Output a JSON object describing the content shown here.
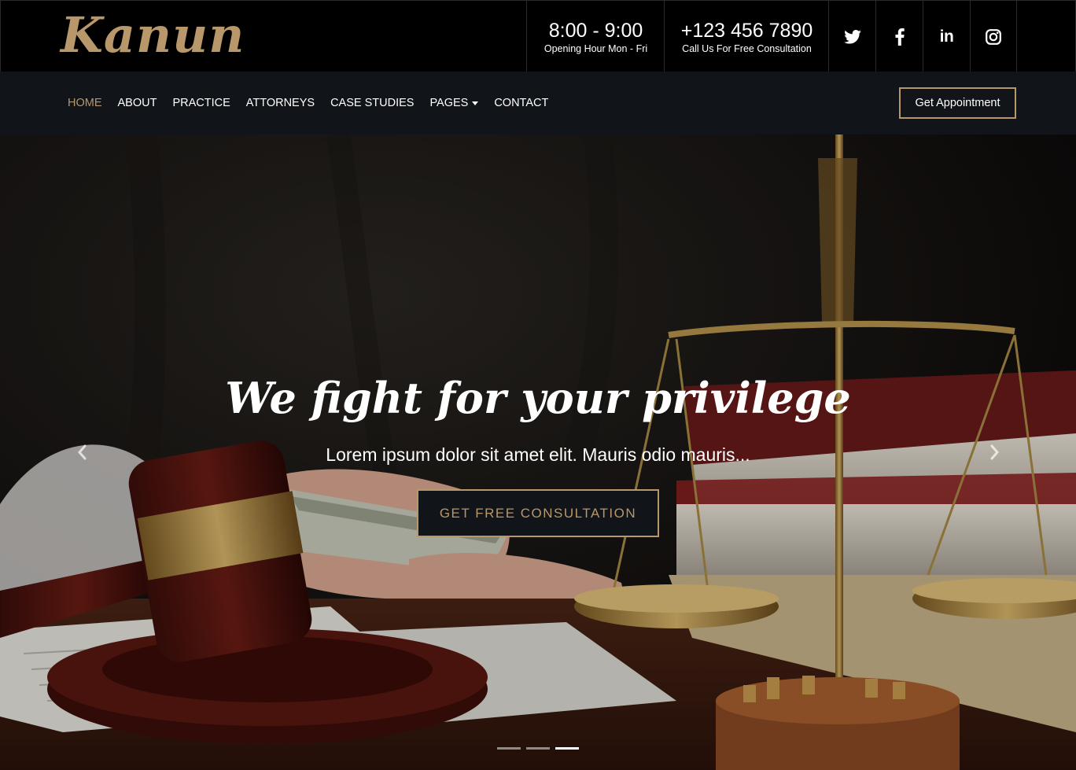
{
  "brand": {
    "logo_text": "Kanun",
    "accent_color": "#b8976a"
  },
  "topbar": {
    "hours": {
      "main": "8:00 - 9:00",
      "sub": "Opening Hour Mon - Fri"
    },
    "phone": {
      "main": "+123 456 7890",
      "sub": "Call Us For Free Consultation"
    },
    "social": [
      {
        "icon": "twitter-icon"
      },
      {
        "icon": "facebook-icon"
      },
      {
        "icon": "linkedin-icon",
        "glyph": "in"
      },
      {
        "icon": "instagram-icon"
      }
    ]
  },
  "nav": {
    "items": [
      {
        "label": "HOME",
        "active": true
      },
      {
        "label": "ABOUT"
      },
      {
        "label": "PRACTICE"
      },
      {
        "label": "ATTORNEYS"
      },
      {
        "label": "CASE STUDIES"
      },
      {
        "label": "PAGES",
        "dropdown": true
      },
      {
        "label": "CONTACT"
      }
    ],
    "cta_label": "Get Appointment",
    "background": "#111418"
  },
  "hero": {
    "title": "We fight for your privilege",
    "subtitle": "Lorem ipsum dolor sit amet elit. Mauris odio mauris...",
    "button_label": "GET FREE CONSULTATION",
    "prev_icon": "chevron-left-icon",
    "next_icon": "chevron-right-icon",
    "slide_count": 3,
    "active_slide": 3
  }
}
